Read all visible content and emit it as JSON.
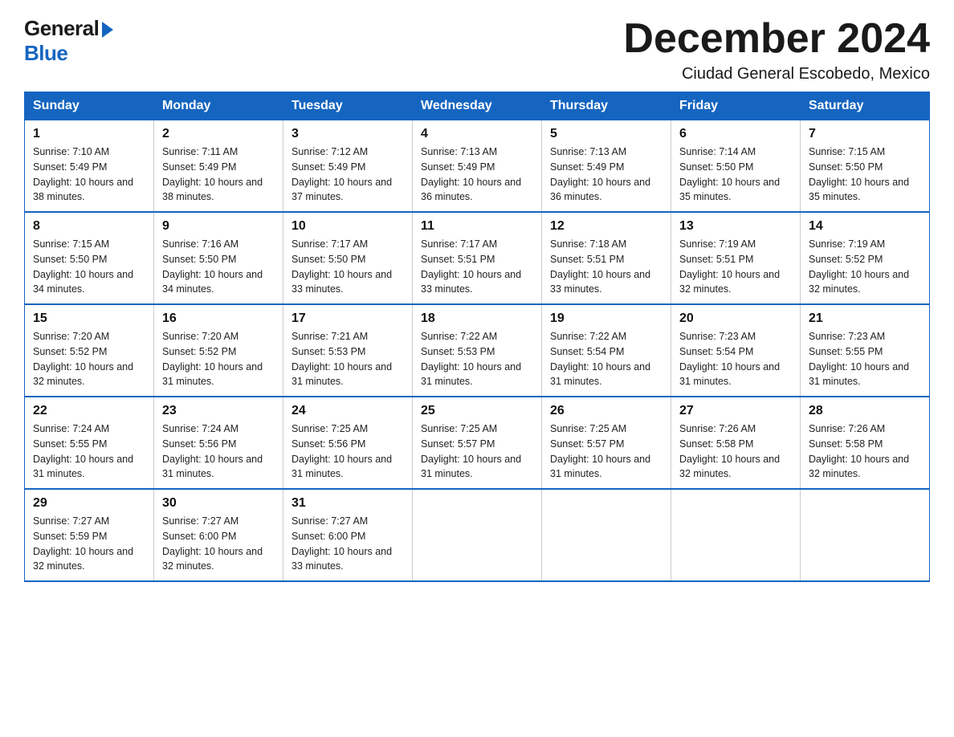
{
  "logo": {
    "general": "General",
    "blue": "Blue"
  },
  "title": "December 2024",
  "location": "Ciudad General Escobedo, Mexico",
  "headers": [
    "Sunday",
    "Monday",
    "Tuesday",
    "Wednesday",
    "Thursday",
    "Friday",
    "Saturday"
  ],
  "weeks": [
    [
      {
        "day": "1",
        "sunrise": "7:10 AM",
        "sunset": "5:49 PM",
        "daylight": "10 hours and 38 minutes."
      },
      {
        "day": "2",
        "sunrise": "7:11 AM",
        "sunset": "5:49 PM",
        "daylight": "10 hours and 38 minutes."
      },
      {
        "day": "3",
        "sunrise": "7:12 AM",
        "sunset": "5:49 PM",
        "daylight": "10 hours and 37 minutes."
      },
      {
        "day": "4",
        "sunrise": "7:13 AM",
        "sunset": "5:49 PM",
        "daylight": "10 hours and 36 minutes."
      },
      {
        "day": "5",
        "sunrise": "7:13 AM",
        "sunset": "5:49 PM",
        "daylight": "10 hours and 36 minutes."
      },
      {
        "day": "6",
        "sunrise": "7:14 AM",
        "sunset": "5:50 PM",
        "daylight": "10 hours and 35 minutes."
      },
      {
        "day": "7",
        "sunrise": "7:15 AM",
        "sunset": "5:50 PM",
        "daylight": "10 hours and 35 minutes."
      }
    ],
    [
      {
        "day": "8",
        "sunrise": "7:15 AM",
        "sunset": "5:50 PM",
        "daylight": "10 hours and 34 minutes."
      },
      {
        "day": "9",
        "sunrise": "7:16 AM",
        "sunset": "5:50 PM",
        "daylight": "10 hours and 34 minutes."
      },
      {
        "day": "10",
        "sunrise": "7:17 AM",
        "sunset": "5:50 PM",
        "daylight": "10 hours and 33 minutes."
      },
      {
        "day": "11",
        "sunrise": "7:17 AM",
        "sunset": "5:51 PM",
        "daylight": "10 hours and 33 minutes."
      },
      {
        "day": "12",
        "sunrise": "7:18 AM",
        "sunset": "5:51 PM",
        "daylight": "10 hours and 33 minutes."
      },
      {
        "day": "13",
        "sunrise": "7:19 AM",
        "sunset": "5:51 PM",
        "daylight": "10 hours and 32 minutes."
      },
      {
        "day": "14",
        "sunrise": "7:19 AM",
        "sunset": "5:52 PM",
        "daylight": "10 hours and 32 minutes."
      }
    ],
    [
      {
        "day": "15",
        "sunrise": "7:20 AM",
        "sunset": "5:52 PM",
        "daylight": "10 hours and 32 minutes."
      },
      {
        "day": "16",
        "sunrise": "7:20 AM",
        "sunset": "5:52 PM",
        "daylight": "10 hours and 31 minutes."
      },
      {
        "day": "17",
        "sunrise": "7:21 AM",
        "sunset": "5:53 PM",
        "daylight": "10 hours and 31 minutes."
      },
      {
        "day": "18",
        "sunrise": "7:22 AM",
        "sunset": "5:53 PM",
        "daylight": "10 hours and 31 minutes."
      },
      {
        "day": "19",
        "sunrise": "7:22 AM",
        "sunset": "5:54 PM",
        "daylight": "10 hours and 31 minutes."
      },
      {
        "day": "20",
        "sunrise": "7:23 AM",
        "sunset": "5:54 PM",
        "daylight": "10 hours and 31 minutes."
      },
      {
        "day": "21",
        "sunrise": "7:23 AM",
        "sunset": "5:55 PM",
        "daylight": "10 hours and 31 minutes."
      }
    ],
    [
      {
        "day": "22",
        "sunrise": "7:24 AM",
        "sunset": "5:55 PM",
        "daylight": "10 hours and 31 minutes."
      },
      {
        "day": "23",
        "sunrise": "7:24 AM",
        "sunset": "5:56 PM",
        "daylight": "10 hours and 31 minutes."
      },
      {
        "day": "24",
        "sunrise": "7:25 AM",
        "sunset": "5:56 PM",
        "daylight": "10 hours and 31 minutes."
      },
      {
        "day": "25",
        "sunrise": "7:25 AM",
        "sunset": "5:57 PM",
        "daylight": "10 hours and 31 minutes."
      },
      {
        "day": "26",
        "sunrise": "7:25 AM",
        "sunset": "5:57 PM",
        "daylight": "10 hours and 31 minutes."
      },
      {
        "day": "27",
        "sunrise": "7:26 AM",
        "sunset": "5:58 PM",
        "daylight": "10 hours and 32 minutes."
      },
      {
        "day": "28",
        "sunrise": "7:26 AM",
        "sunset": "5:58 PM",
        "daylight": "10 hours and 32 minutes."
      }
    ],
    [
      {
        "day": "29",
        "sunrise": "7:27 AM",
        "sunset": "5:59 PM",
        "daylight": "10 hours and 32 minutes."
      },
      {
        "day": "30",
        "sunrise": "7:27 AM",
        "sunset": "6:00 PM",
        "daylight": "10 hours and 32 minutes."
      },
      {
        "day": "31",
        "sunrise": "7:27 AM",
        "sunset": "6:00 PM",
        "daylight": "10 hours and 33 minutes."
      },
      null,
      null,
      null,
      null
    ]
  ],
  "labels": {
    "sunrise_prefix": "Sunrise: ",
    "sunset_prefix": "Sunset: ",
    "daylight_prefix": "Daylight: "
  }
}
